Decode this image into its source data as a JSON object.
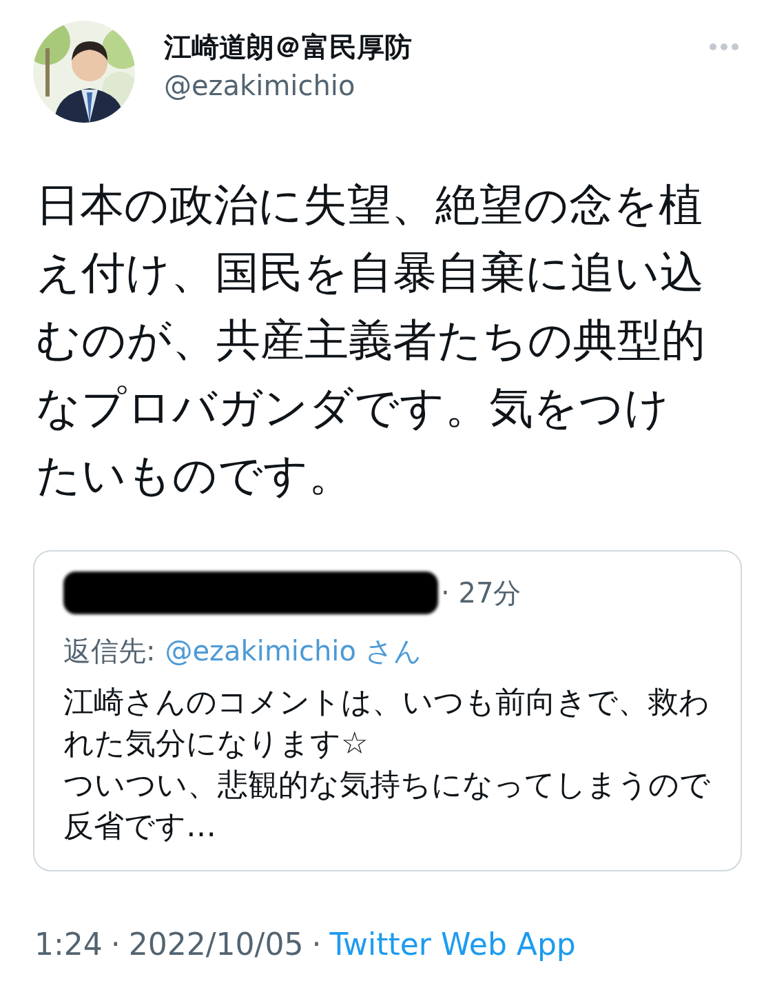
{
  "tweet": {
    "display_name": "江崎道朗＠富民厚防",
    "handle": "@ezakimichio",
    "text": "日本の政治に失望、絶望の念を植え付け、国民を自暴自棄に追い込むのが、共産主義者たちの典型的なプロバガンダです。気をつけたいものです。",
    "quoted": {
      "redacted": true,
      "separator": "·",
      "time": "27分",
      "reply_label": "返信先:",
      "reply_to": "@ezakimichio さん",
      "text": "江崎さんのコメントは、いつも前向きで、救われた気分になります☆\nついつい、悲観的な気持ちになってしまうので反省です…"
    },
    "footer": {
      "time": "1:24",
      "separator": "·",
      "date": "2022/10/05",
      "source": "Twitter Web App"
    }
  }
}
